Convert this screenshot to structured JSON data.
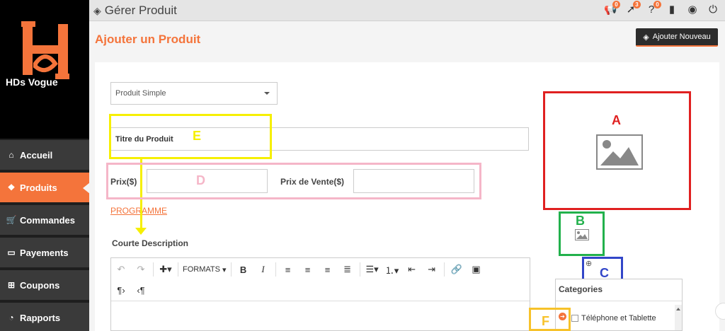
{
  "window": {
    "title": "Gérer Produit"
  },
  "brand": {
    "name": "HDs Vogue",
    "accent": "#f4743b"
  },
  "sidebar": {
    "items": [
      {
        "label": "Accueil",
        "icon": "home-icon",
        "active": false
      },
      {
        "label": "Produits",
        "icon": "cubes-icon",
        "active": true
      },
      {
        "label": "Commandes",
        "icon": "cart-icon",
        "active": false
      },
      {
        "label": "Payements",
        "icon": "credit-card-icon",
        "active": false
      },
      {
        "label": "Coupons",
        "icon": "gift-icon",
        "active": false
      },
      {
        "label": "Rapports",
        "icon": "pie-chart-icon",
        "active": false
      }
    ]
  },
  "topbar": {
    "icons": [
      {
        "name": "megaphone-icon",
        "badge": "0"
      },
      {
        "name": "paper-plane-icon",
        "badge": "3"
      },
      {
        "name": "question-icon",
        "badge": "0"
      },
      {
        "name": "book-icon",
        "badge": ""
      },
      {
        "name": "user-icon",
        "badge": ""
      },
      {
        "name": "power-icon",
        "badge": ""
      }
    ]
  },
  "page": {
    "heading": "Ajouter un Produit",
    "add_new_label": "Ajouter Nouveau"
  },
  "form": {
    "product_type": "Produit Simple",
    "title_placeholder": "Titre du Produit",
    "price_label": "Prix($)",
    "sale_price_label": "Prix de Vente($)",
    "schedule_link": "PROGRAMME",
    "short_desc_label": "Courte Description",
    "editor_formats": "FORMATS"
  },
  "categories": {
    "title": "Categories",
    "items": [
      "Téléphone et Tablette"
    ]
  },
  "annotations": {
    "A": "A",
    "B": "B",
    "C": "C",
    "D": "D",
    "E": "E",
    "F": "F",
    "colors": {
      "A": "#e02020",
      "B": "#22b14c",
      "C": "#3246c8",
      "D": "#f5b6c8",
      "E": "#f6ef00",
      "F": "#f7c22a"
    }
  }
}
